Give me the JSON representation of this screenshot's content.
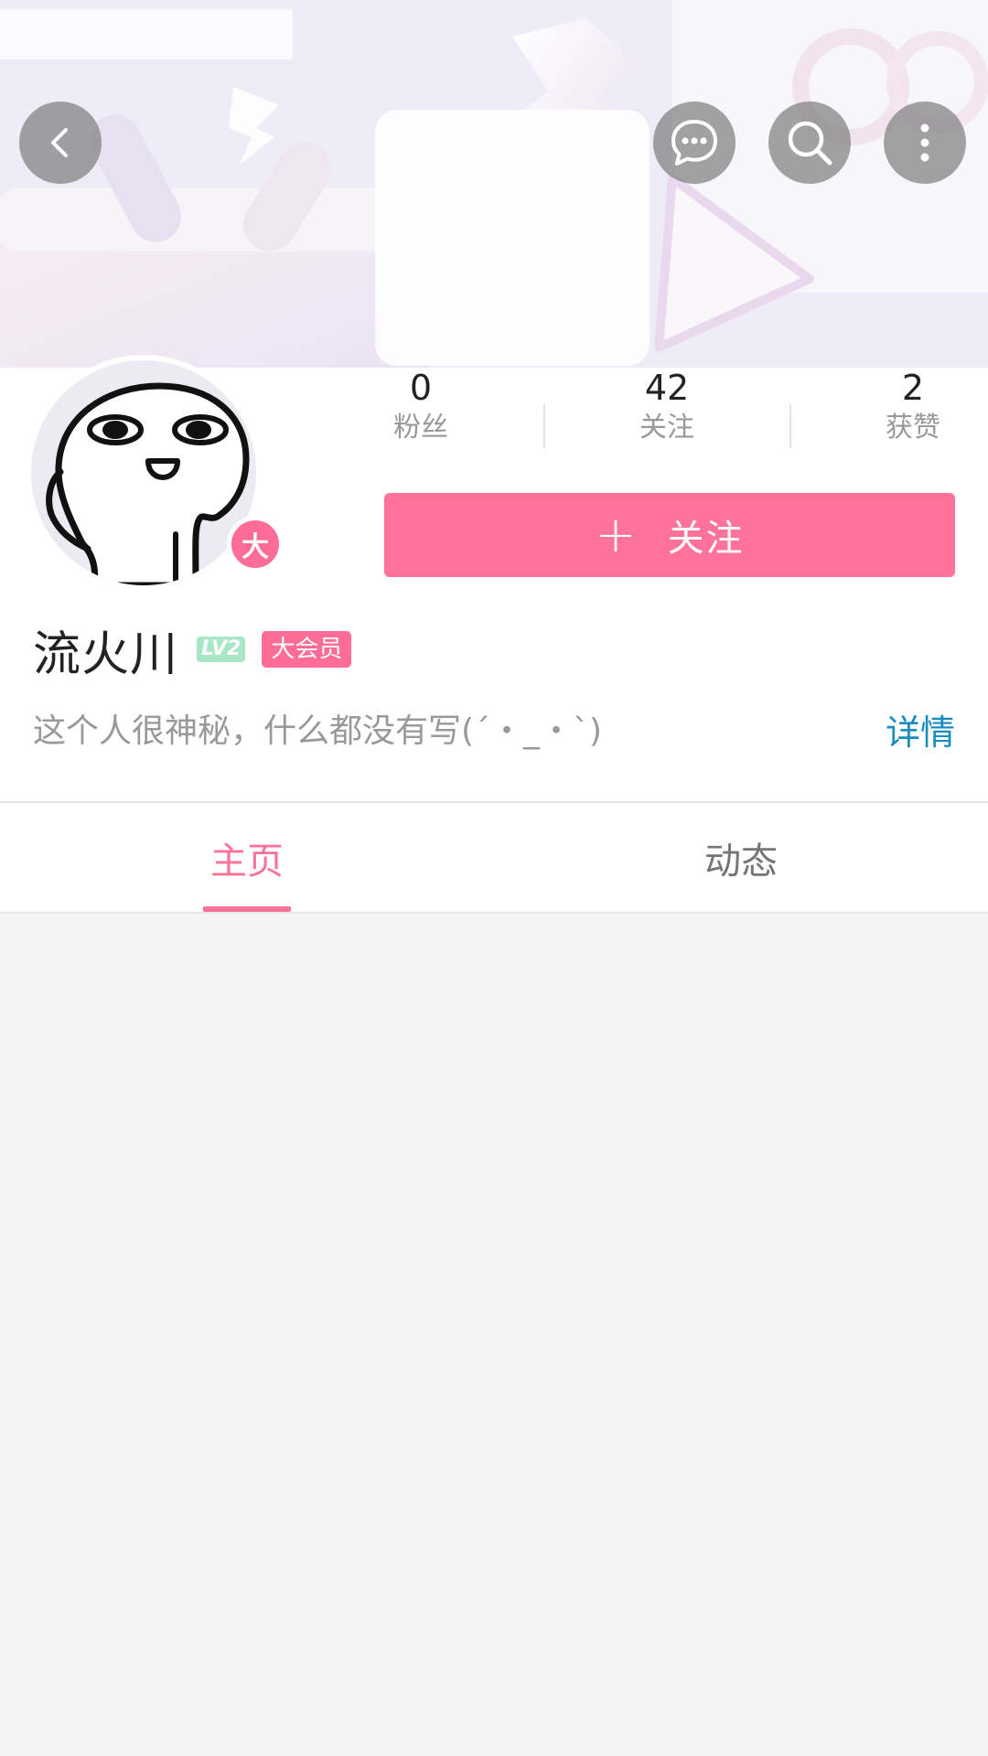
{
  "header": {
    "back_icon": "chevron-left-icon",
    "message_icon": "chat-bubble-icon",
    "search_icon": "search-icon",
    "more_icon": "more-vertical-icon"
  },
  "profile": {
    "avatar_badge": "大",
    "stats": [
      {
        "value": "0",
        "label": "粉丝"
      },
      {
        "value": "42",
        "label": "关注"
      },
      {
        "value": "2",
        "label": "获赞"
      }
    ],
    "follow_button": {
      "icon": "+",
      "label": "关注"
    },
    "username": "流火川",
    "level_badge": "LV2",
    "member_badge": "大会员",
    "bio": "这个人很神秘，什么都没有写(´・_・`)",
    "detail_link": "详情"
  },
  "tabs": [
    {
      "label": "主页",
      "active": true
    },
    {
      "label": "动态",
      "active": false
    }
  ],
  "colors": {
    "accent": "#fb7299",
    "follow_button": "#ff7299",
    "link": "#1a8dc0",
    "level_badge": "#a8e6c5"
  }
}
